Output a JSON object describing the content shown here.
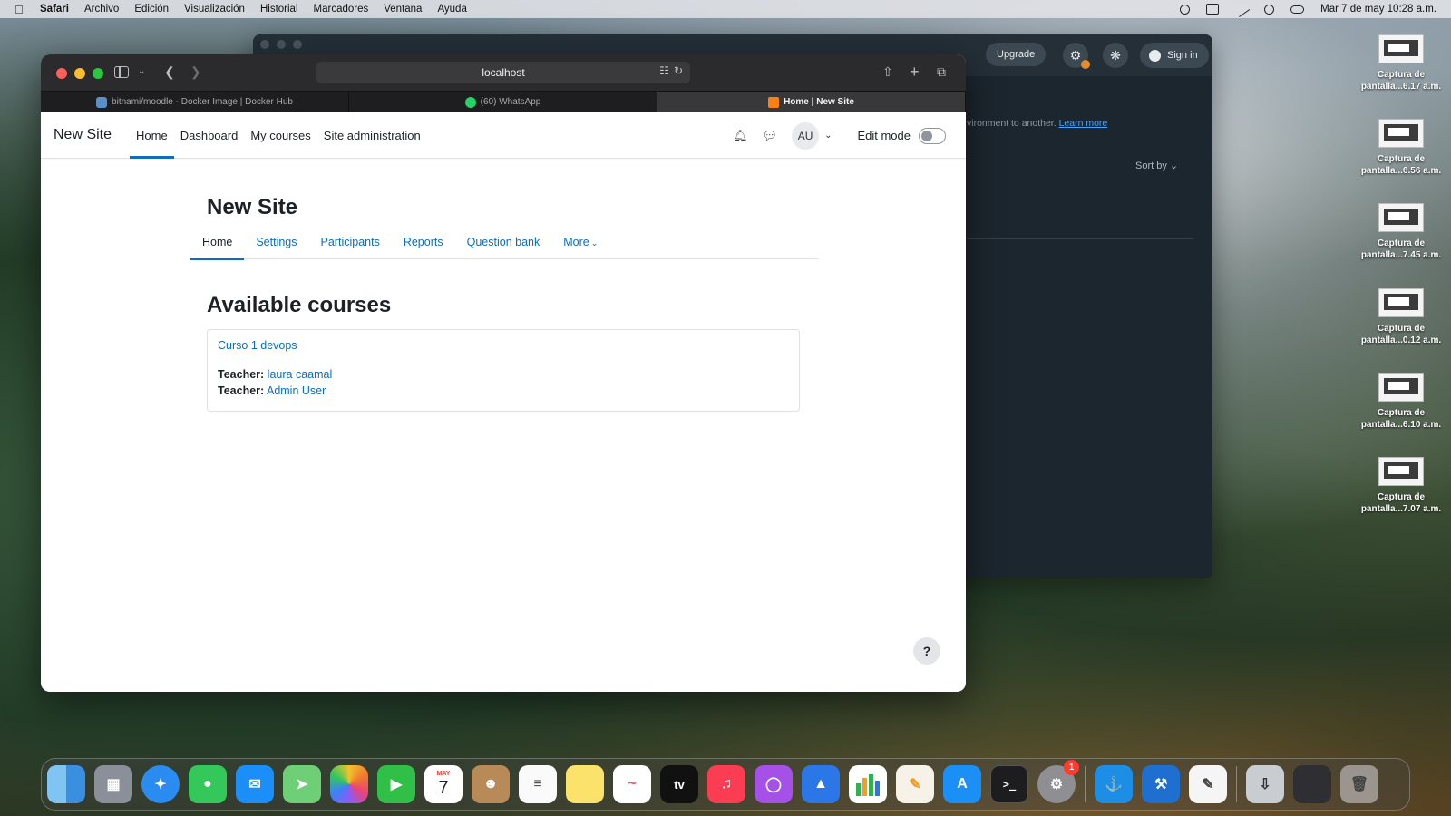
{
  "menubar": {
    "app": "Safari",
    "items": [
      "Archivo",
      "Edición",
      "Visualización",
      "Historial",
      "Marcadores",
      "Ventana",
      "Ayuda"
    ],
    "datetime": "Mar 7 de may  10:28 a.m."
  },
  "docker_window": {
    "upgrade_label": "Upgrade",
    "signin_label": "Sign in",
    "text": "vironment to another.",
    "learn_more": "Learn more",
    "sort_by": "Sort by"
  },
  "safari": {
    "url": "localhost",
    "tabs": [
      {
        "label": "bitnami/moodle - Docker Image | Docker Hub",
        "icon": "docker-icon"
      },
      {
        "label": "(60) WhatsApp",
        "icon": "whatsapp-icon"
      },
      {
        "label": "Home | New Site",
        "icon": "moodle-icon"
      }
    ]
  },
  "moodle": {
    "site_name": "New Site",
    "nav": [
      "Home",
      "Dashboard",
      "My courses",
      "Site administration"
    ],
    "user_initials": "AU",
    "edit_mode_label": "Edit mode",
    "page_title": "New Site",
    "secondary_nav": [
      "Home",
      "Settings",
      "Participants",
      "Reports",
      "Question bank",
      "More"
    ],
    "section_title": "Available courses",
    "course": {
      "name": "Curso 1 devops",
      "teacher_label": "Teacher:",
      "teachers": [
        "laura caamal",
        "Admin User"
      ]
    },
    "help_label": "?"
  },
  "desktop_files": [
    "Captura de pantalla...6.17 a.m.",
    "Captura de pantalla...6.56 a.m.",
    "Captura de pantalla...7.45 a.m.",
    "Captura de pantalla...0.12 a.m.",
    "Captura de pantalla...6.10 a.m.",
    "Captura de pantalla...7.07 a.m."
  ],
  "dock": {
    "calendar_month": "MAY",
    "calendar_day": "7",
    "tv_label": "tv",
    "settings_badge": "1"
  },
  "colors": {
    "moodle_link": "#0f6cbf",
    "safari_toolbar": "#2b2b2d"
  }
}
